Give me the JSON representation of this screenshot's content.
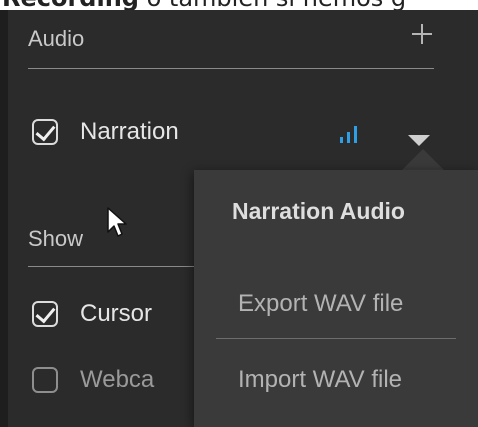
{
  "caption": {
    "bold": "Recording",
    "rest": " o también si hemos g"
  },
  "audio_section": {
    "title": "Audio",
    "add_icon": "plus-icon",
    "items": [
      {
        "label": "Narration",
        "checked": true,
        "level_icon": "audio-level-icon",
        "menu_icon": "chevron-down-icon"
      }
    ]
  },
  "show_section": {
    "title": "Show",
    "items": [
      {
        "label": "Cursor",
        "checked": true
      },
      {
        "label": "Webca",
        "checked": false
      }
    ]
  },
  "popup": {
    "title": "Narration Audio",
    "items": [
      "Export WAV file",
      "Import WAV file"
    ]
  },
  "colors": {
    "background": "#2b2b2b",
    "popup": "#3a3a3a",
    "accent_blue": "#2e9fe6"
  }
}
